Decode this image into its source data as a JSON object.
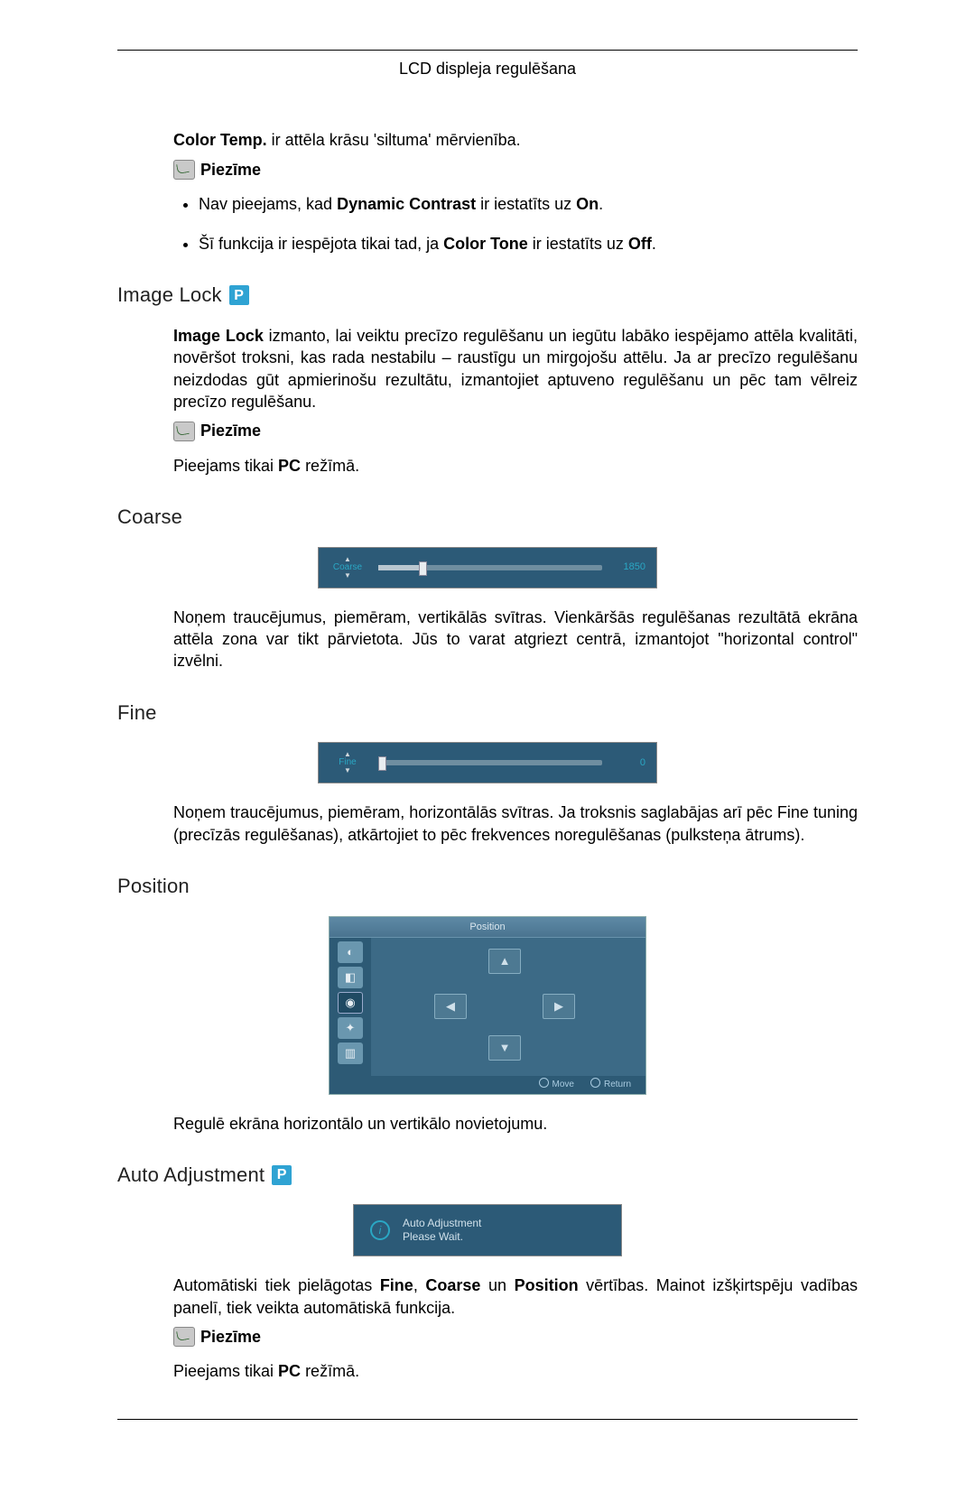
{
  "header": {
    "title": "LCD displeja regulēšana"
  },
  "colortemp": {
    "intro_prefix_bold": "Color Temp.",
    "intro_rest": " ir attēla krāsu 'siltuma' mērvienība.",
    "note_label": "Piezīme",
    "bullets": [
      {
        "text_before": "Nav pieejams, kad ",
        "bold": "Dynamic Contrast",
        "text_mid": " ir iestatīts uz ",
        "bold2": "On",
        "text_after": "."
      },
      {
        "text_before": "Šī funkcija ir iespējota tikai tad, ja ",
        "bold": "Color Tone",
        "text_mid": " ir iestatīts uz ",
        "bold2": "Off",
        "text_after": "."
      }
    ]
  },
  "imagelock": {
    "title": "Image Lock",
    "para_prefix_bold": "Image Lock",
    "para_rest": " izmanto, lai veiktu precīzo regulēšanu un iegūtu labāko iespējamo attēla kvalitāti, novēršot troksni, kas rada nestabilu – raustīgu un mirgojošu attēlu. Ja ar precīzo regulēšanu neizdodas gūt apmierinošu rezultātu, izmantojiet aptuveno regulēšanu un pēc tam vēlreiz precīzo regulēšanu.",
    "note_label": "Piezīme",
    "pc_only_before": "Pieejams tikai ",
    "pc_only_bold": "PC",
    "pc_only_after": " režīmā."
  },
  "coarse": {
    "title": "Coarse",
    "slider_label": "Coarse",
    "slider_value": "1850",
    "desc": "Noņem traucējumus, piemēram, vertikālās svītras. Vienkāršās regulēšanas rezultātā ekrāna attēla zona var tikt pārvietota. Jūs to varat atgriezt centrā, izmantojot \"horizontal control\" izvēlni."
  },
  "fine": {
    "title": "Fine",
    "slider_label": "Fine",
    "slider_value": "0",
    "desc": "Noņem traucējumus, piemēram, horizontālās svītras. Ja troksnis saglabājas arī pēc Fine tuning (precīzās regulēšanas), atkārtojiet to pēc frekvences noregulēšanas (pulksteņa ātrums)."
  },
  "position": {
    "title": "Position",
    "menu_title": "Position",
    "footer_move": "Move",
    "footer_return": "Return",
    "desc": "Regulē ekrāna horizontālo un vertikālo novietojumu."
  },
  "auto": {
    "title": "Auto Adjustment",
    "osd_line1": "Auto Adjustment",
    "osd_line2": "Please Wait.",
    "desc_before": "Automātiski tiek pielāgotas ",
    "bold1": "Fine",
    "mid1": ", ",
    "bold2": "Coarse",
    "mid2": " un ",
    "bold3": "Position",
    "desc_after": " vērtības. Mainot izšķirtspēju vadības panelī, tiek veikta automātiskā funkcija.",
    "note_label": "Piezīme",
    "pc_only_before": "Pieejams tikai ",
    "pc_only_bold": "PC",
    "pc_only_after": " režīmā."
  },
  "chart_data": [
    {
      "type": "bar",
      "title": "Coarse slider",
      "categories": [
        "Coarse"
      ],
      "values": [
        1850
      ],
      "xlim": [
        0,
        9999
      ]
    },
    {
      "type": "bar",
      "title": "Fine slider",
      "categories": [
        "Fine"
      ],
      "values": [
        0
      ],
      "xlim": [
        0,
        100
      ]
    }
  ]
}
